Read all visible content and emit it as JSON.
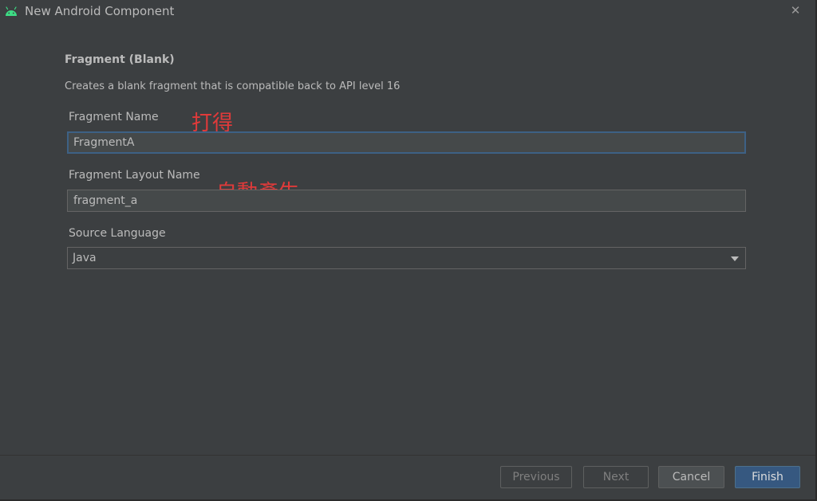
{
  "window": {
    "title": "New Android Component",
    "icon": "android-icon",
    "close_glyph": "✕"
  },
  "page": {
    "heading": "Fragment (Blank)",
    "description": "Creates a blank fragment that is compatible back to API level 16"
  },
  "fields": {
    "fragment_name": {
      "label": "Fragment Name",
      "value": "FragmentA",
      "annotation": "打得"
    },
    "layout_name": {
      "label": "Fragment Layout Name",
      "value": "fragment_a",
      "annotation": "自動產生"
    },
    "source_language": {
      "label": "Source Language",
      "value": "Java"
    }
  },
  "buttons": {
    "previous": "Previous",
    "next": "Next",
    "cancel": "Cancel",
    "finish": "Finish"
  },
  "colors": {
    "background": "#3c3f41",
    "text": "#bbbbbb",
    "accent": "#365880",
    "focus_border": "#3d6185",
    "annotation": "#e03a3a",
    "android_green": "#3ddc84"
  }
}
